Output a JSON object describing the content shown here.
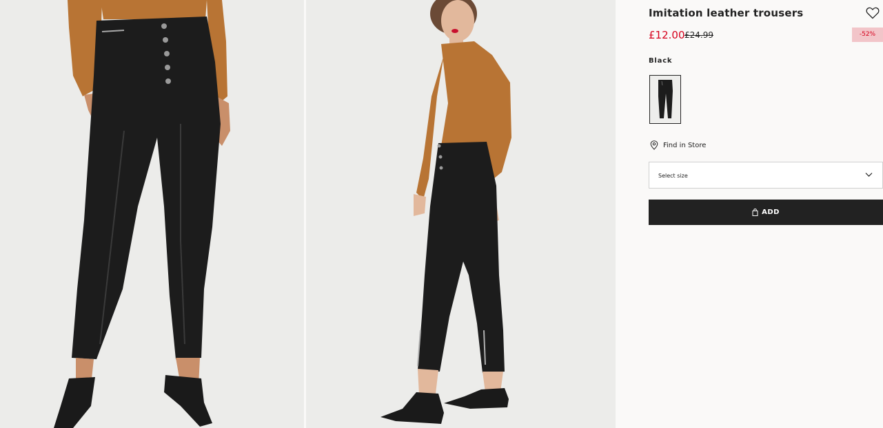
{
  "product": {
    "title": "Imitation leather trousers",
    "price_current": "£12.00",
    "price_original": "£24.99",
    "discount_badge": "-52%",
    "color_name": "Black",
    "find_in_store": "Find in Store",
    "size_select_placeholder": "Select size",
    "add_button_label": "ADD"
  },
  "icons": {
    "favourite": "heart-icon",
    "store": "map-pin-icon",
    "dropdown": "chevron-down-icon",
    "bag": "shopping-bag-icon"
  },
  "colors": {
    "sale_red": "#d6001c",
    "discount_bg": "#f2c5c9",
    "button_bg": "#222222",
    "page_bg": "#faf9f8",
    "photo_bg": "#ececea",
    "top_color": "#b87434",
    "trousers_color": "#1c1c1c"
  }
}
